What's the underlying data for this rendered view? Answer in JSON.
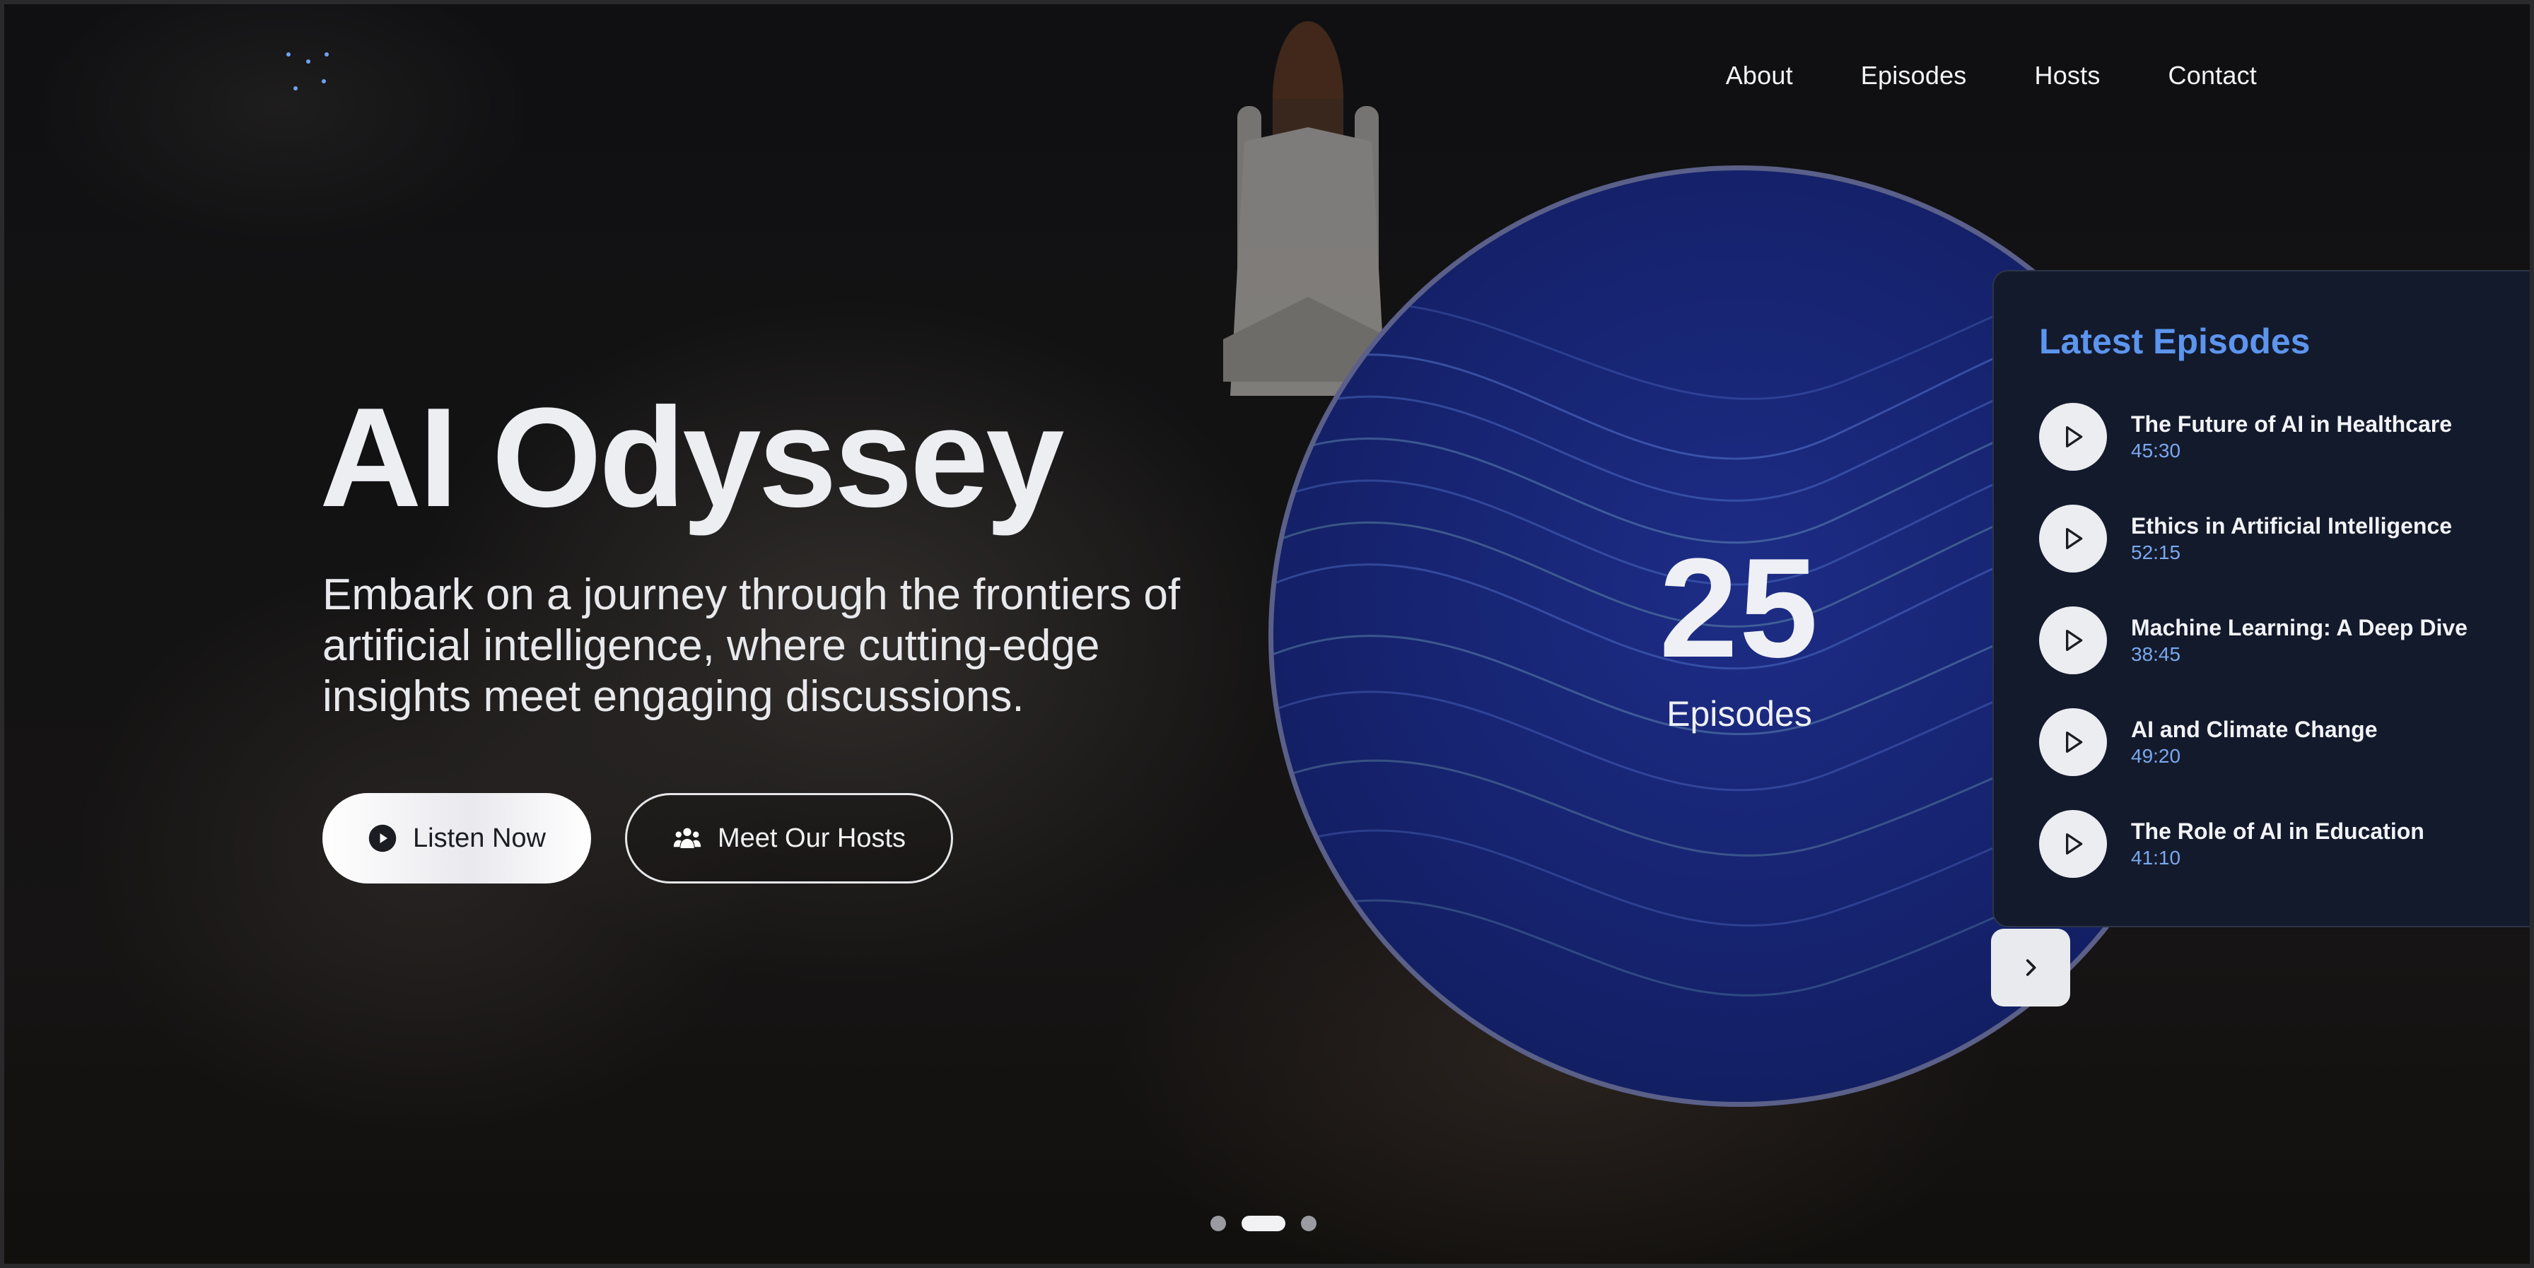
{
  "nav": {
    "items": [
      {
        "label": "About"
      },
      {
        "label": "Episodes"
      },
      {
        "label": "Hosts"
      },
      {
        "label": "Contact"
      }
    ]
  },
  "hero": {
    "title": "AI Odyssey",
    "subtitle": "Embark on a journey through the frontiers of artificial intelligence, where cutting-edge insights meet engaging discussions.",
    "primary_button": {
      "label": "Listen Now",
      "icon": "play-circle-icon"
    },
    "secondary_button": {
      "label": "Meet Our Hosts",
      "icon": "users-icon"
    }
  },
  "stats": {
    "count": "25",
    "label": "Episodes"
  },
  "episodes_panel": {
    "title": "Latest Episodes",
    "items": [
      {
        "title": "The Future of AI in Healthcare",
        "duration": "45:30"
      },
      {
        "title": "Ethics in Artificial Intelligence",
        "duration": "52:15"
      },
      {
        "title": "Machine Learning: A Deep Dive",
        "duration": "38:45"
      },
      {
        "title": "AI and Climate Change",
        "duration": "49:20"
      },
      {
        "title": "The Role of AI in Education",
        "duration": "41:10"
      }
    ],
    "next_icon": "chevron-right-icon"
  },
  "pagination": {
    "count": 3,
    "active_index": 1
  },
  "colors": {
    "accent": "#5c95ee",
    "duration": "#7aa8ee",
    "panel_bg": "#131a2c",
    "circle_bg": "#172472"
  }
}
